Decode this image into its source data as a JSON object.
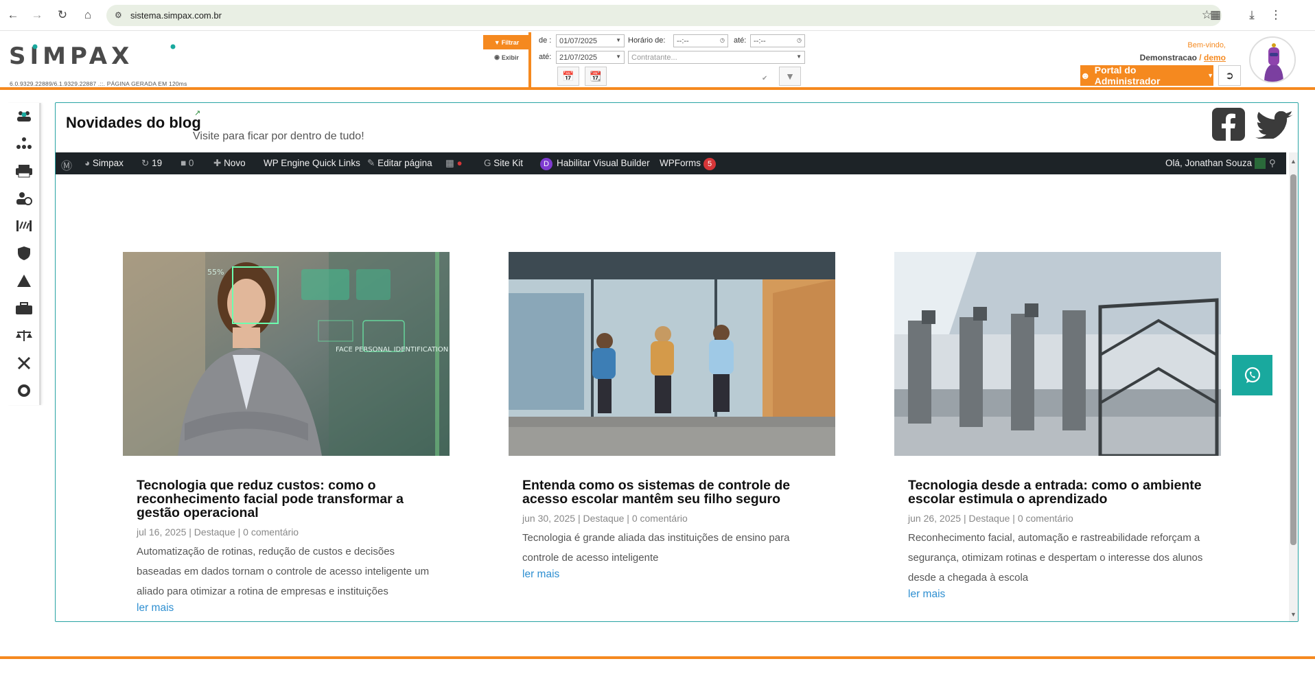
{
  "browser": {
    "url": "sistema.simpax.com.br"
  },
  "header": {
    "logo_text": "SIMPAX",
    "version": "6.0.9329.22889/6.1.9329.22887 .::. PÁGINA GERADA EM 120ms",
    "filter_label": "Filtrar",
    "show_label": "Exibir",
    "from_label": "de :",
    "to_label": "até:",
    "date_from": "01/07/2025",
    "date_to": "21/07/2025",
    "time_label": "Horário de:",
    "time_to_label": "até:",
    "time_from": "--:--",
    "time_to": "--:--",
    "contractor_placeholder": "Contratante...",
    "welcome": "Bem-vindo,",
    "user_name": "Demonstracao",
    "user_sep": " / ",
    "user_link": "demo",
    "portal_label": "Portal do Administrador"
  },
  "blog": {
    "title": "Novidades do blog",
    "subtitle": "Visite para ficar por dentro de tudo!"
  },
  "wpbar": {
    "site": "Simpax",
    "updates": "19",
    "comments": "0",
    "new": "Novo",
    "quick_links": "WP Engine Quick Links",
    "edit": "Editar página",
    "sitekit": "Site Kit",
    "visual_builder": "Habilitar Visual Builder",
    "wpforms": "WPForms",
    "wpforms_badge": "5",
    "greeting": "Olá, Jonathan Souza"
  },
  "posts": [
    {
      "title": "Tecnologia que reduz custos: como o reconhecimento facial pode transformar a gestão operacional",
      "meta": "jul 16, 2025 | Destaque | 0 comentário",
      "excerpt": "Automatização de rotinas, redução de custos e decisões baseadas em dados tornam o controle de acesso inteligente um aliado para otimizar a rotina de empresas e instituições",
      "more": "ler mais",
      "img_text_1": "55%",
      "img_text_2": "FACE PERSONAL IDENTIFICATION"
    },
    {
      "title": "Entenda como os sistemas de controle de acesso escolar mantêm seu filho seguro",
      "meta": "jun 30, 2025 | Destaque | 0 comentário",
      "excerpt": "Tecnologia é grande aliada das instituições de ensino para controle de acesso inteligente",
      "more": "ler mais"
    },
    {
      "title": "Tecnologia desde a entrada: como o ambiente escolar estimula o aprendizado",
      "meta": "jun 26, 2025 | Destaque | 0 comentário",
      "excerpt": "Reconhecimento facial, automação e rastreabilidade reforçam a segurança, otimizam rotinas e despertam o interesse dos alunos desde a chegada à escola",
      "more": "ler mais"
    }
  ],
  "colors": {
    "accent": "#f5891f",
    "frame": "#27a3a3",
    "whatsapp": "#19a99e",
    "link": "#2e8fd1"
  }
}
